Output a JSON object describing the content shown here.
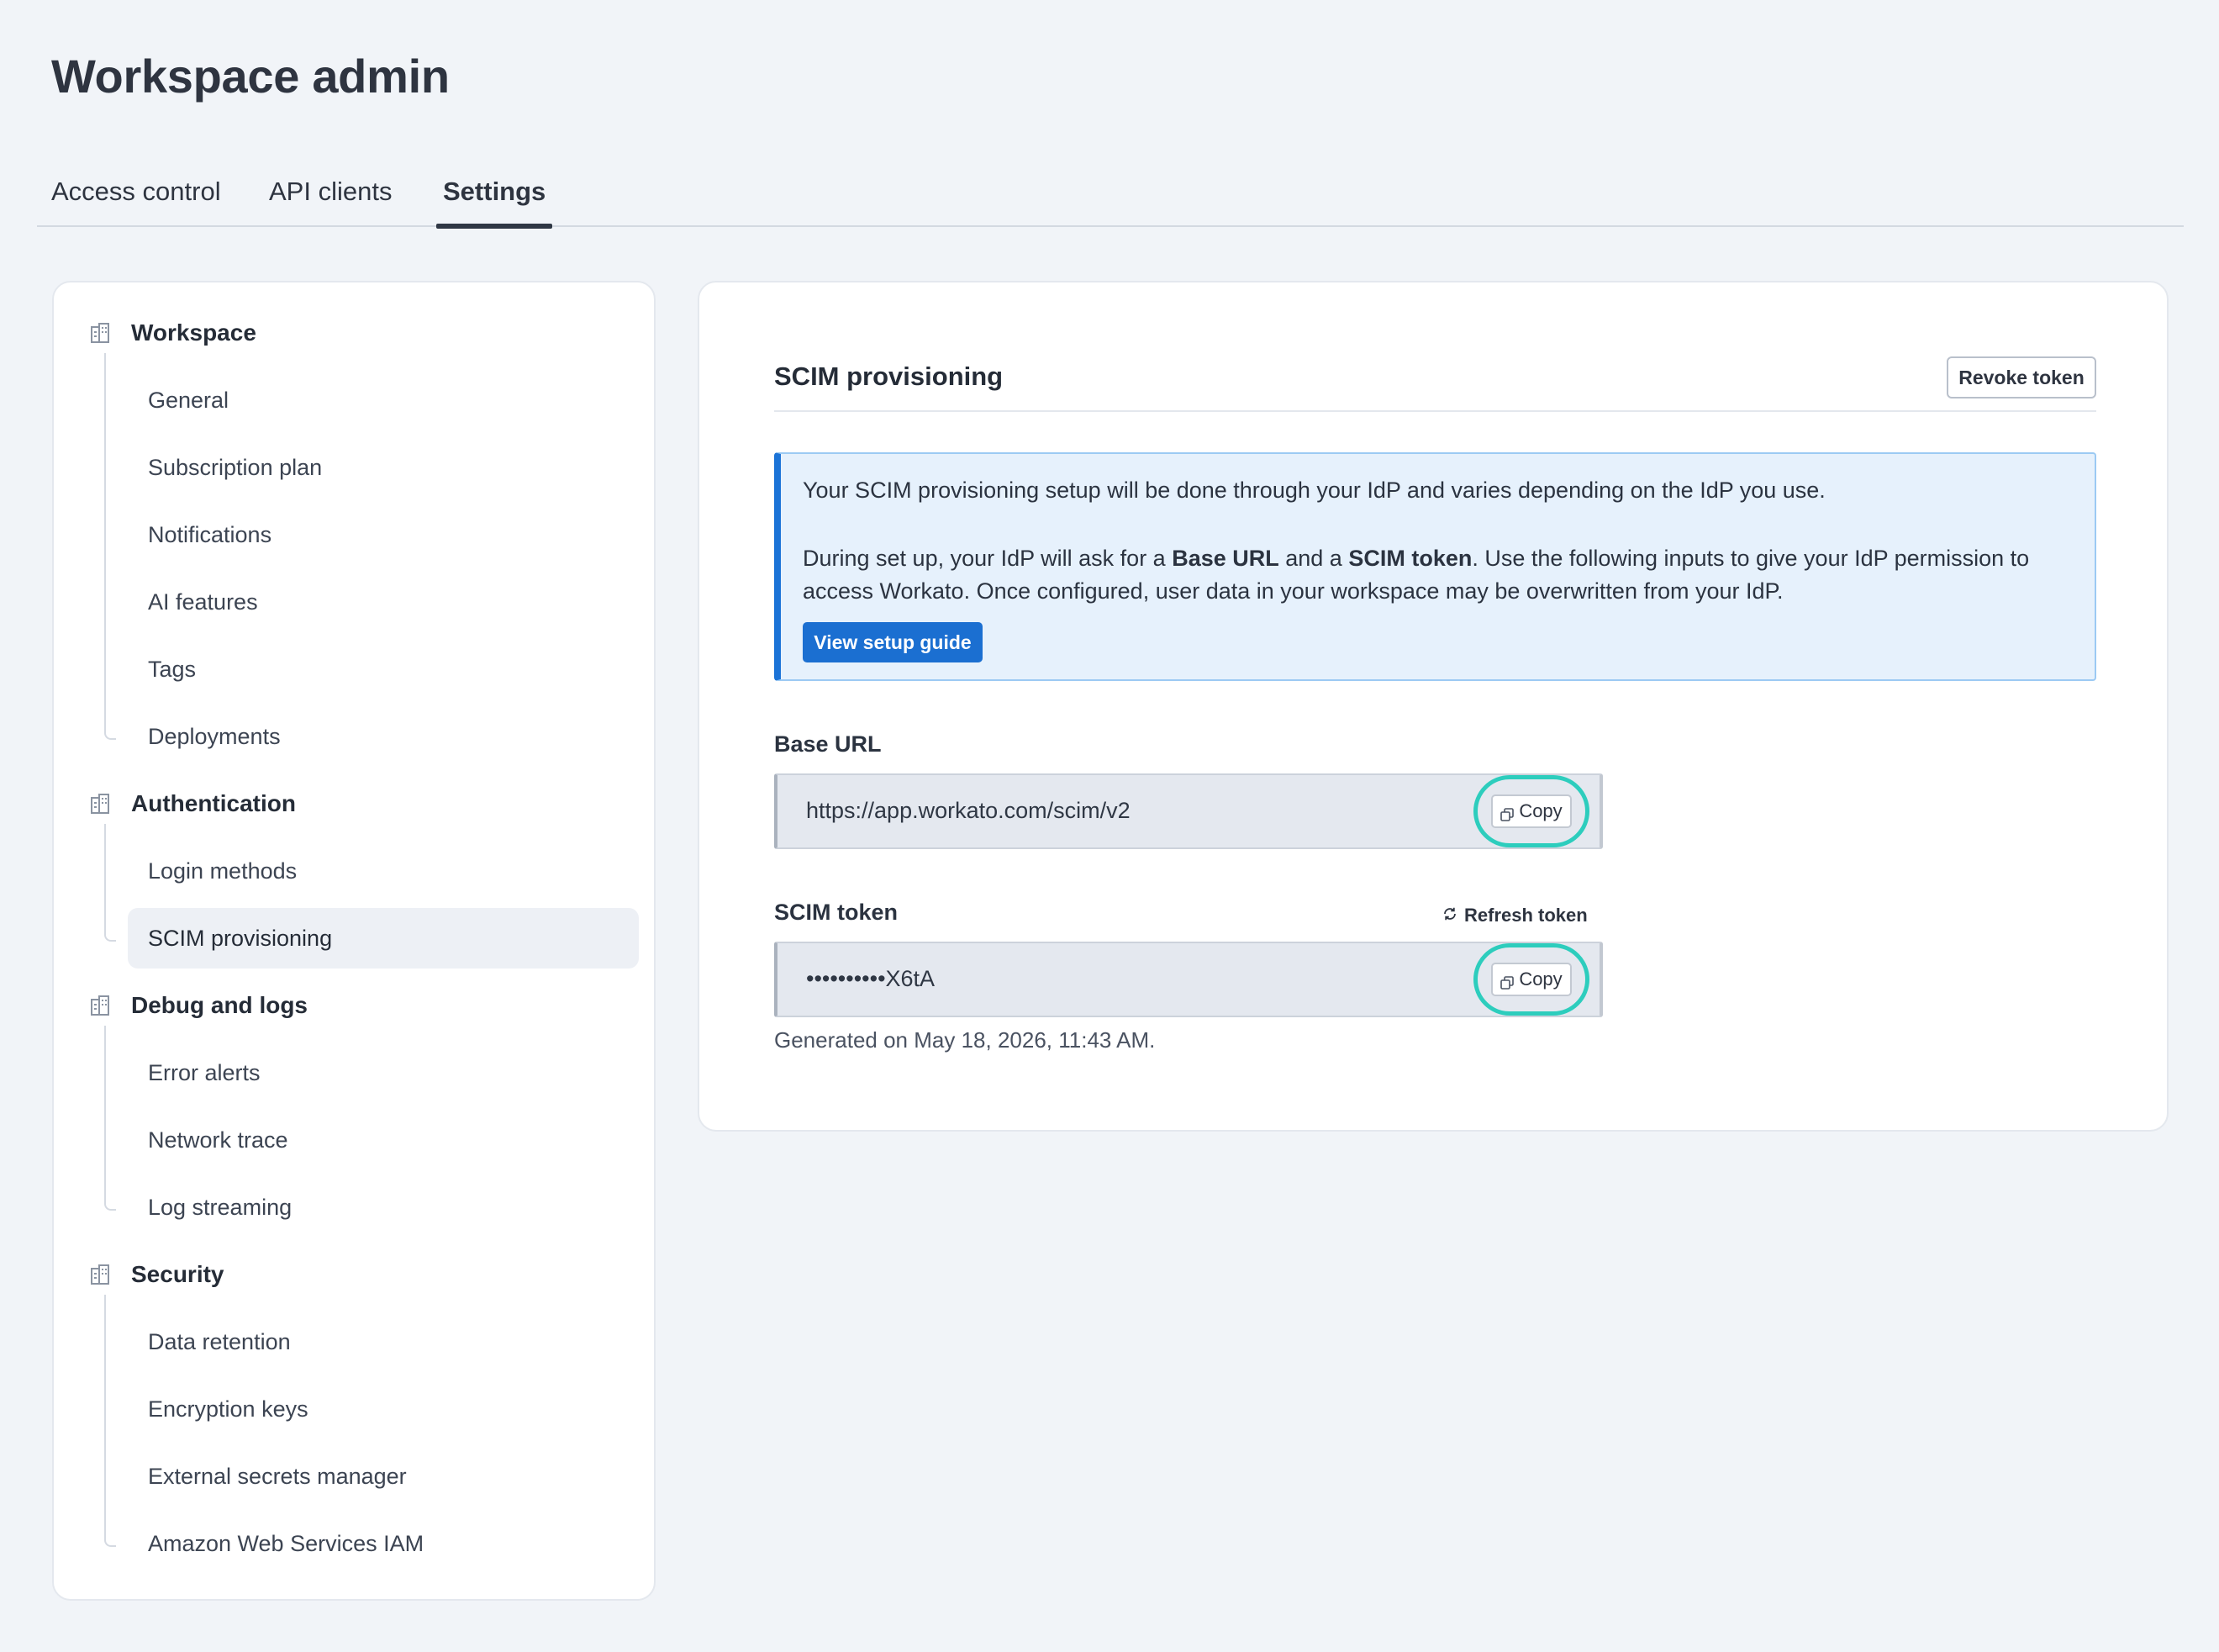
{
  "page": {
    "title": "Workspace admin"
  },
  "tabs": [
    {
      "label": "Access control",
      "active": false
    },
    {
      "label": "API clients",
      "active": false
    },
    {
      "label": "Settings",
      "active": true
    }
  ],
  "sidebar": {
    "sections": [
      {
        "label": "Workspace",
        "icon": "building-icon",
        "items": [
          "General",
          "Subscription plan",
          "Notifications",
          "AI features",
          "Tags",
          "Deployments"
        ]
      },
      {
        "label": "Authentication",
        "icon": "building-icon",
        "items": [
          "Login methods",
          "SCIM provisioning"
        ]
      },
      {
        "label": "Debug and logs",
        "icon": "building-icon",
        "items": [
          "Error alerts",
          "Network trace",
          "Log streaming"
        ]
      },
      {
        "label": "Security",
        "icon": "building-icon",
        "items": [
          "Data retention",
          "Encryption keys",
          "External secrets manager",
          "Amazon Web Services IAM"
        ]
      }
    ],
    "active_item": "SCIM provisioning"
  },
  "main": {
    "title": "SCIM provisioning",
    "revoke_label": "Revoke token",
    "info": {
      "line1": "Your SCIM provisioning setup will be done through your IdP and varies depending on the IdP you use.",
      "line2_a": "During set up, your IdP will ask for a ",
      "line2_b": "Base URL",
      "line2_c": " and a ",
      "line2_d": "SCIM token",
      "line2_e": ". Use the following inputs to give your IdP permission to access Workato. Once configured, user data in your workspace may be overwritten from your IdP.",
      "button": "View setup guide"
    },
    "base_url": {
      "label": "Base URL",
      "value": "https://app.workato.com/scim/v2",
      "copy": "Copy"
    },
    "scim_token": {
      "label": "SCIM token",
      "value": "••••••••••X6tA",
      "copy": "Copy",
      "refresh": "Refresh token"
    },
    "generated": "Generated on May 18, 2026, 11:43 AM."
  },
  "colors": {
    "accent": "#1b6fd1",
    "highlight_ring": "#2dcdbd",
    "info_bg": "#e6f1fc"
  }
}
